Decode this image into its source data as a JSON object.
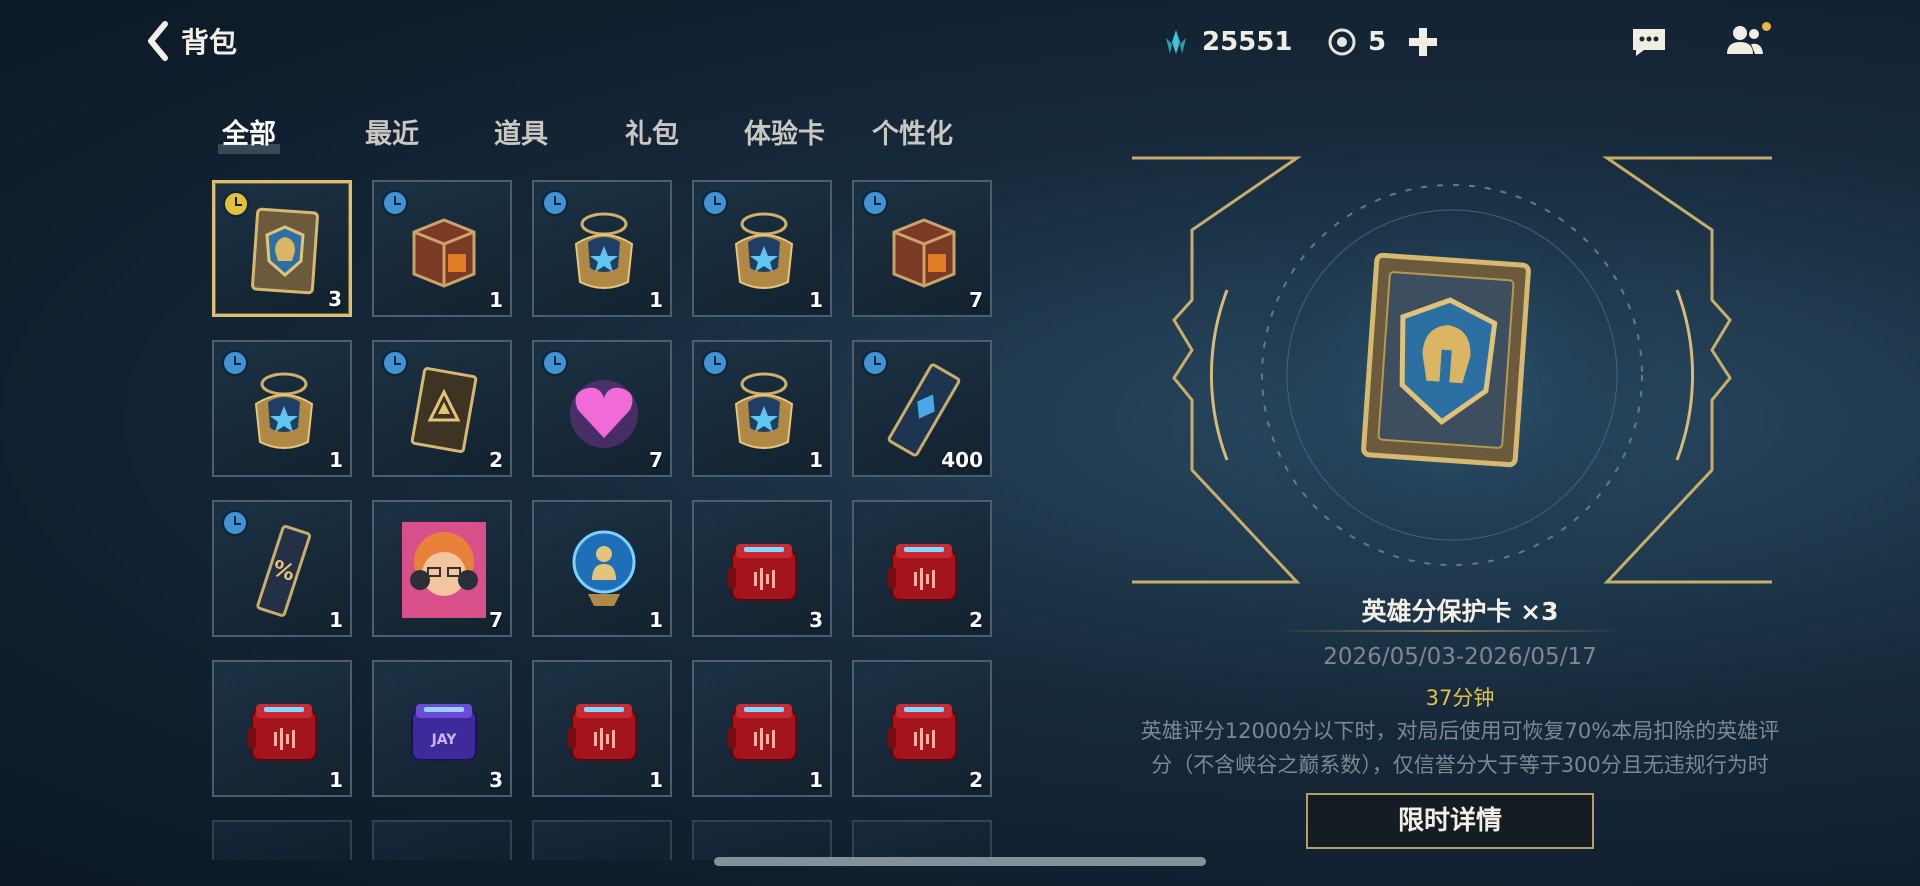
{
  "header": {
    "back_label": "背包",
    "currency_rp": "25551",
    "currency_orb": "5"
  },
  "tabs": [
    "全部",
    "最近",
    "道具",
    "礼包",
    "体验卡",
    "个性化"
  ],
  "items": [
    {
      "icon": "hero-protect-card-icon",
      "qty": "3",
      "timed": true,
      "selected": true
    },
    {
      "icon": "chest-cube-icon",
      "qty": "1",
      "timed": true
    },
    {
      "icon": "blue-orb-chest-icon",
      "qty": "1",
      "timed": true
    },
    {
      "icon": "blue-orb-chest-icon",
      "qty": "1",
      "timed": true
    },
    {
      "icon": "chest-cube-icon",
      "qty": "7",
      "timed": true
    },
    {
      "icon": "blue-orb-chest-icon",
      "qty": "1",
      "timed": true
    },
    {
      "icon": "gold-rune-card-icon",
      "qty": "2",
      "timed": true
    },
    {
      "icon": "pink-heart-icon",
      "qty": "7",
      "timed": true
    },
    {
      "icon": "blue-orb-chest-icon",
      "qty": "1",
      "timed": true
    },
    {
      "icon": "blue-ticket-icon",
      "qty": "400",
      "timed": true
    },
    {
      "icon": "discount-ticket-icon",
      "qty": "1",
      "timed": true
    },
    {
      "icon": "champion-portrait-icon",
      "qty": "7",
      "timed": false
    },
    {
      "icon": "crystal-ball-icon",
      "qty": "1",
      "timed": false
    },
    {
      "icon": "red-loot-box-icon",
      "qty": "3",
      "timed": false
    },
    {
      "icon": "red-loot-box-icon",
      "qty": "2",
      "timed": false
    },
    {
      "icon": "red-loot-box-icon",
      "qty": "1",
      "timed": false
    },
    {
      "icon": "purple-loot-box-icon",
      "qty": "3",
      "timed": false
    },
    {
      "icon": "red-loot-box-icon",
      "qty": "1",
      "timed": false
    },
    {
      "icon": "red-loot-box-icon",
      "qty": "1",
      "timed": false
    },
    {
      "icon": "red-loot-box-icon",
      "qty": "2",
      "timed": false
    }
  ],
  "detail": {
    "name": "英雄分保护卡 ×3",
    "dates": "2026/05/03-2026/05/17",
    "timer": "37分钟",
    "desc_line1": "英雄评分12000分以下时，对局后使用可恢复70%本局扣除的英雄评",
    "desc_line2": "分（不含峡谷之巅系数），仅信誉分大于等于300分且无违规行为时",
    "button_label": "限时详情"
  },
  "colors": {
    "accent_gold": "#d9bf78",
    "timer_yellow": "#e1c34a",
    "clock_blue": "#3f93d4"
  }
}
